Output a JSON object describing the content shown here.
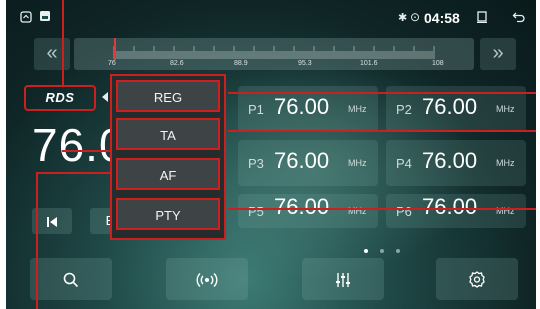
{
  "status_bar": {
    "home_icon": "home-icon",
    "notification_icon": "notification-icon",
    "bluetooth_icon": "bluetooth-icon",
    "location_icon": "location-icon",
    "time": "04:58",
    "window_icon": "window-icon",
    "back_icon": "back-arrow-icon"
  },
  "tuner": {
    "prev_arrow": "«",
    "next_arrow": "»",
    "scale_labels": [
      "76",
      "82.6",
      "88.9",
      "95.3",
      "101.6",
      "108"
    ],
    "rds_logo": "RDS",
    "current_frequency": "76.0"
  },
  "menu": {
    "items": [
      {
        "label": "REG"
      },
      {
        "label": "TA"
      },
      {
        "label": "AF"
      },
      {
        "label": "PTY"
      }
    ]
  },
  "presets": [
    {
      "label": "P1",
      "freq": "76.00",
      "unit": "MHz"
    },
    {
      "label": "P2",
      "freq": "76.00",
      "unit": "MHz"
    },
    {
      "label": "P3",
      "freq": "76.00",
      "unit": "MHz"
    },
    {
      "label": "P4",
      "freq": "76.00",
      "unit": "MHz"
    },
    {
      "label": "P5",
      "freq": "76.00",
      "unit": "MHz"
    },
    {
      "label": "P6",
      "freq": "76.00",
      "unit": "MHz"
    }
  ],
  "controls": {
    "prev_icon": "skip-previous-icon",
    "band_label": "B"
  },
  "bottom_bar": {
    "search_icon": "search-icon",
    "radio_icon": "radio-signal-icon",
    "equalizer_icon": "equalizer-icon",
    "settings_icon": "gear-icon"
  },
  "colors": {
    "accent": "#cc1f1f",
    "background": "#1f4947"
  }
}
